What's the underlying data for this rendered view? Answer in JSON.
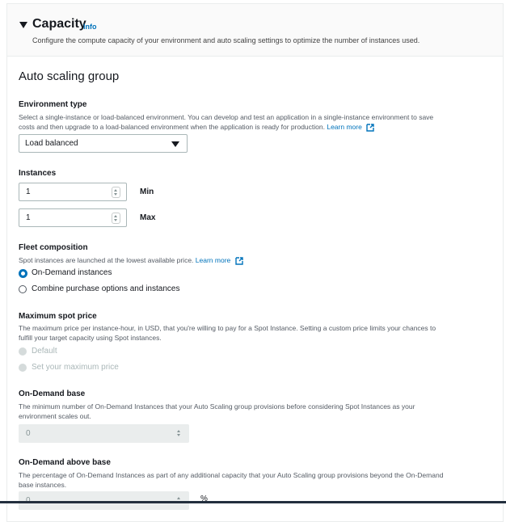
{
  "header": {
    "title": "Capacity",
    "info": "Info",
    "description": "Configure the compute capacity of your environment and auto scaling settings to optimize the number of instances used."
  },
  "section_title": "Auto scaling group",
  "environment_type": {
    "label": "Environment type",
    "desc_line1": "Select a single-instance or load-balanced environment. You can develop and test an application in a single-instance environment to save",
    "desc_line2": "costs and then upgrade to a load-balanced environment when the application is ready for production.",
    "learn_more": "Learn more",
    "selected": "Load balanced"
  },
  "instances": {
    "label": "Instances",
    "min_value": "1",
    "min_label": "Min",
    "max_value": "1",
    "max_label": "Max"
  },
  "fleet": {
    "label": "Fleet composition",
    "desc": "Spot instances are launched at the lowest available price.",
    "learn_more": "Learn more",
    "option_on_demand": "On-Demand instances",
    "option_combine": "Combine purchase options and instances"
  },
  "max_spot": {
    "label": "Maximum spot price",
    "desc_line1": "The maximum price per instance-hour, in USD, that you're willing to pay for a Spot Instance. Setting a custom price limits your chances to",
    "desc_line2": "fulfill your target capacity using Spot instances.",
    "option_default": "Default",
    "option_custom": "Set your maximum price"
  },
  "on_demand_base": {
    "label": "On-Demand base",
    "desc_line1": "The minimum number of On-Demand Instances that your Auto Scaling group provisions before considering Spot Instances as your",
    "desc_line2": "environment scales out.",
    "value": "0"
  },
  "on_demand_above": {
    "label": "On-Demand above base",
    "desc_line1": "The percentage of On-Demand Instances as part of any additional capacity that your Auto Scaling group provisions beyond the On-Demand",
    "desc_line2": "base instances.",
    "value": "0",
    "unit": "%"
  },
  "colors": {
    "link": "#0073bb",
    "radio_selected": "#0073bb",
    "border": "#aab7b8"
  }
}
